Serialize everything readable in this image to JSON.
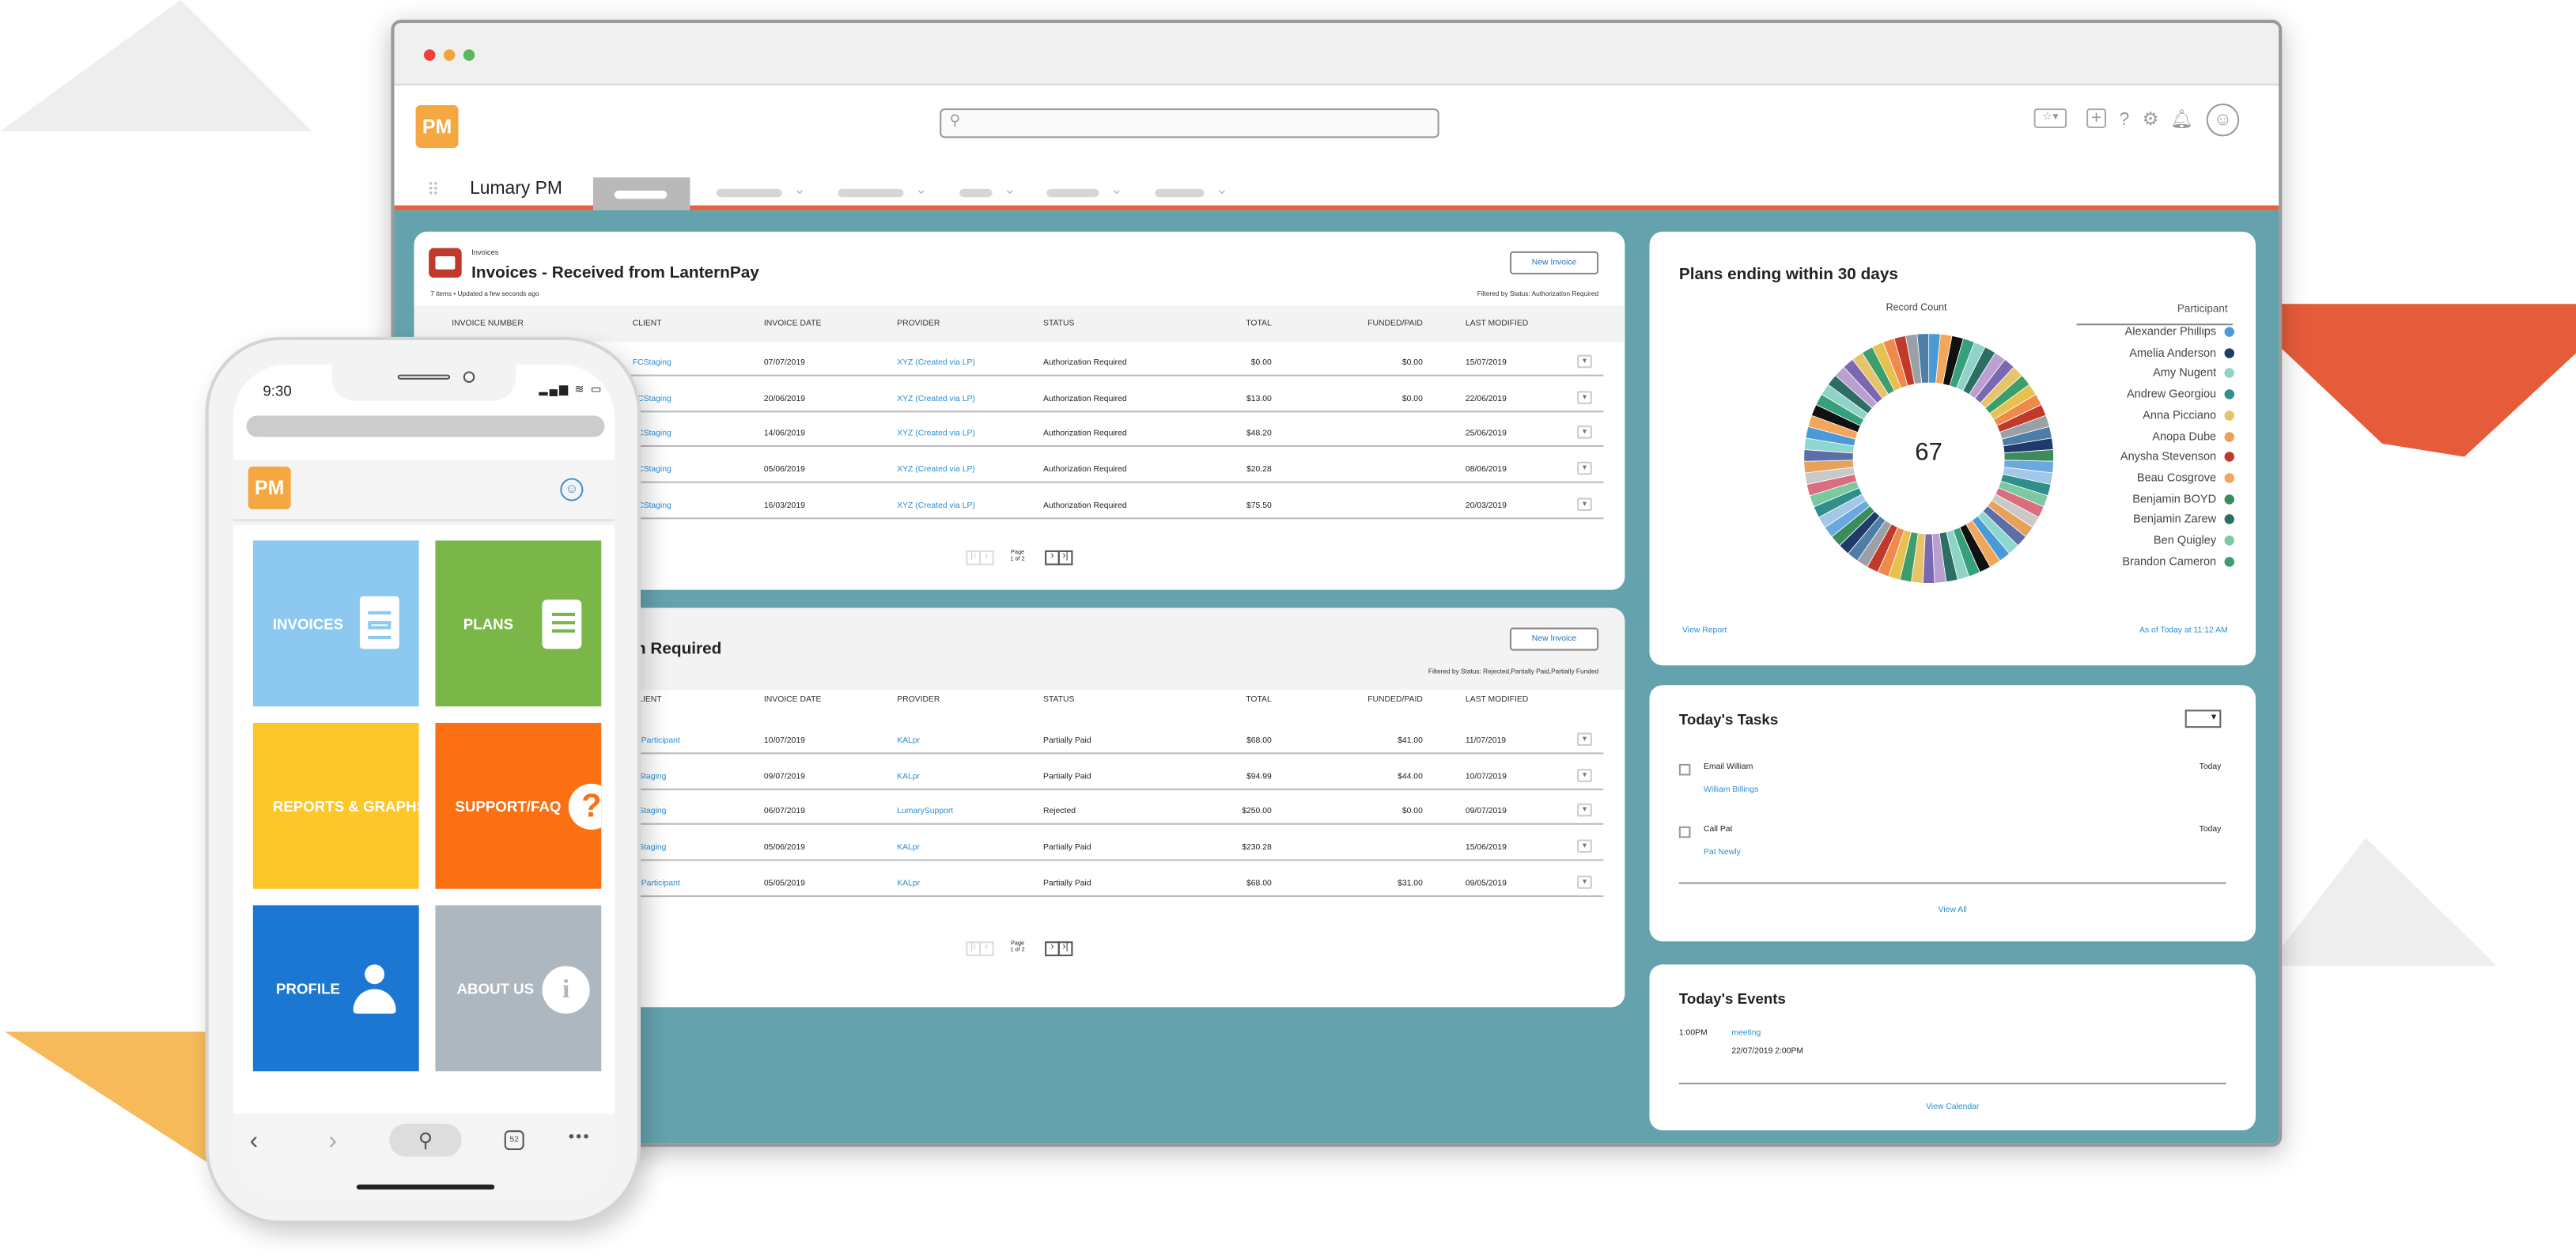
{
  "app": {
    "logo": "PM",
    "name": "Lumary PM"
  },
  "colors": {
    "brand_orange": "#f5a742",
    "accent_red": "#e8603c",
    "teal_bg": "#64a3ad",
    "link_blue": "#2a8fd0"
  },
  "header_icons": [
    "star-icon",
    "add-icon",
    "help-icon",
    "settings-icon",
    "bell-icon",
    "avatar-icon"
  ],
  "invoice_columns": [
    "INVOICE NUMBER",
    "CLIENT",
    "INVOICE DATE",
    "PROVIDER",
    "STATUS",
    "TOTAL",
    "FUNDED/PAID",
    "LAST MODIFIED"
  ],
  "invoices1": {
    "breadcrumb": "Invoices",
    "title": "Invoices - Received from LanternPay",
    "meta": "7 items • Updated a few seconds ago",
    "filter": "Filtered by Status: Authorization Required",
    "new_button": "New Invoice",
    "page_label": "Page",
    "page_of": "1 of 2",
    "rows": [
      {
        "client": "FCStaging",
        "date": "07/07/2019",
        "provider": "XYZ (Created via LP)",
        "status": "Authorization Required",
        "total": "$0.00",
        "funded": "$0.00",
        "modified": "15/07/2019"
      },
      {
        "client": "FCStaging",
        "date": "20/06/2019",
        "provider": "XYZ (Created via LP)",
        "status": "Authorization Required",
        "total": "$13.00",
        "funded": "$0.00",
        "modified": "22/06/2019"
      },
      {
        "client": "FCStaging",
        "date": "14/06/2019",
        "provider": "XYZ (Created via LP)",
        "status": "Authorization Required",
        "total": "$48.20",
        "funded": "",
        "modified": "25/06/2019"
      },
      {
        "client": "FCStaging",
        "date": "05/06/2019",
        "provider": "XYZ (Created via LP)",
        "status": "Authorization Required",
        "total": "$20.28",
        "funded": "",
        "modified": "08/06/2019"
      },
      {
        "client": "FCStaging",
        "date": "16/03/2019",
        "provider": "XYZ (Created via LP)",
        "status": "Authorization Required",
        "total": "$75.50",
        "funded": "",
        "modified": "20/03/2019"
      }
    ]
  },
  "invoices2": {
    "title_visible": "n Required",
    "filter": "Filtered by Status: Rejected,Partially Paid,Partially Funded",
    "new_button": "New Invoice",
    "page_label": "Page",
    "page_of": "1 of 2",
    "rows": [
      {
        "client": "ty Participant",
        "date": "10/07/2019",
        "provider": "KALpr",
        "status": "Partially Paid",
        "total": "$68.00",
        "funded": "$41.00",
        "modified": "11/07/2019"
      },
      {
        "client": "CStaging",
        "date": "09/07/2019",
        "provider": "KALpr",
        "status": "Partially Paid",
        "total": "$94.99",
        "funded": "$44.00",
        "modified": "10/07/2019"
      },
      {
        "client": "CStaging",
        "date": "06/07/2019",
        "provider": "LumarySupport",
        "status": "Rejected",
        "total": "$250.00",
        "funded": "$0.00",
        "modified": "09/07/2019"
      },
      {
        "client": "CStaging",
        "date": "05/06/2019",
        "provider": "KALpr",
        "status": "Partially Paid",
        "total": "$230.28",
        "funded": "",
        "modified": "15/06/2019"
      },
      {
        "client": "ty Participant",
        "date": "05/05/2019",
        "provider": "KALpr",
        "status": "Partially Paid",
        "total": "$68.00",
        "funded": "$31.00",
        "modified": "09/05/2019"
      }
    ]
  },
  "plans": {
    "title": "Plans ending within 30 days",
    "record_label": "Record Count",
    "total": "67",
    "legend_title": "Participant",
    "view_report": "View Report",
    "as_of": "As of Today at 11:12 AM"
  },
  "chart_data": {
    "type": "pie",
    "title": "Plans ending within 30 days",
    "subtitle": "Record Count",
    "total": 67,
    "legend_title": "Participant",
    "legend_placement": "right",
    "categories": [
      "Alexander Phillips",
      "Amelia Anderson",
      "Amy Nugent",
      "Andrew Georgiou",
      "Anna Picciano",
      "Anopa Dube",
      "Anysha Stevenson",
      "Beau Cosgrove",
      "Benjamin BOYD",
      "Benjamin Zarew",
      "Ben Quigley",
      "Brandon Cameron"
    ],
    "values": [
      1,
      1,
      1,
      1,
      1,
      1,
      1,
      1,
      1,
      1,
      1,
      1
    ],
    "colors": [
      "#4a9ad6",
      "#1f3a6b",
      "#8fd3c8",
      "#2f8f8a",
      "#e7c36a",
      "#e8a15a",
      "#c0392b",
      "#f2a65a",
      "#3a8c5c",
      "#2c6e63",
      "#7cc8a0",
      "#3e9e6b"
    ]
  },
  "tasks": {
    "title": "Today's Tasks",
    "items": [
      {
        "name": "Email William",
        "who": "William Billings",
        "when": "Today"
      },
      {
        "name": "Call Pat",
        "who": "Pat Newly",
        "when": "Today"
      }
    ],
    "view_all": "View All"
  },
  "events": {
    "title": "Today's Events",
    "time": "1:00PM",
    "name": "meeting",
    "datetime": "22/07/2019 2:00PM",
    "view_calendar": "View Calendar"
  },
  "phone": {
    "time": "9:30",
    "logo": "PM",
    "tiles": [
      {
        "label": "INVOICES",
        "icon": "document-icon",
        "color": "#8cc8f0"
      },
      {
        "label": "PLANS",
        "icon": "book-icon",
        "color": "#7ab648"
      },
      {
        "label": "REPORTS & GRAPHS",
        "icon": "",
        "color": "#fdc629"
      },
      {
        "label": "SUPPORT/FAQ",
        "icon": "question-icon",
        "color": "#fa7012"
      },
      {
        "label": "PROFILE",
        "icon": "person-icon",
        "color": "#1c77d2"
      },
      {
        "label": "ABOUT US",
        "icon": "info-icon",
        "color": "#adb7bf"
      }
    ],
    "tab_count": "52"
  }
}
